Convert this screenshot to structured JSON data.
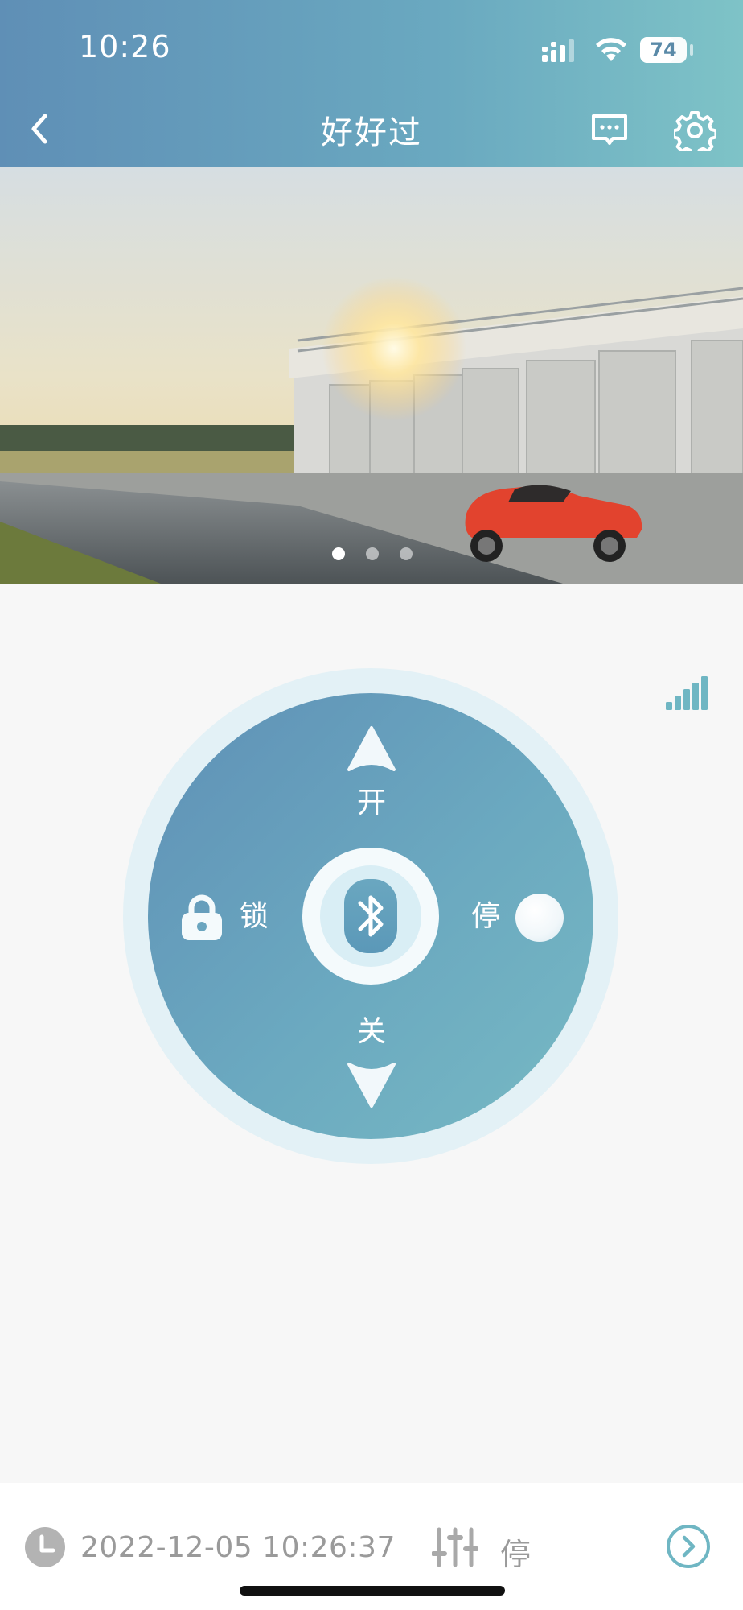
{
  "status_bar": {
    "time": "10:26",
    "battery": "74",
    "battery_level": 0.74
  },
  "header": {
    "title": "好好过",
    "back_icon": "chevron-left-icon",
    "message_icon": "message-icon",
    "settings_icon": "gear-icon"
  },
  "banner": {
    "slide_count": 3,
    "active_slide": 1
  },
  "control_pad": {
    "open_label": "开",
    "close_label": "关",
    "lock_label": "锁",
    "stop_label": "停",
    "center_icon": "bluetooth-icon"
  },
  "bottom_bar": {
    "timestamp": "2022-12-05 10:26:37",
    "mode": "停",
    "next_icon": "chevron-right-circle-icon"
  },
  "colors": {
    "header_start": "#5f8fb6",
    "header_end": "#7ec3c7",
    "accent": "#6fb6c3",
    "pad_ring": "#e3f1f6",
    "muted_text": "#9a9a9a",
    "background": "#f7f7f7"
  }
}
